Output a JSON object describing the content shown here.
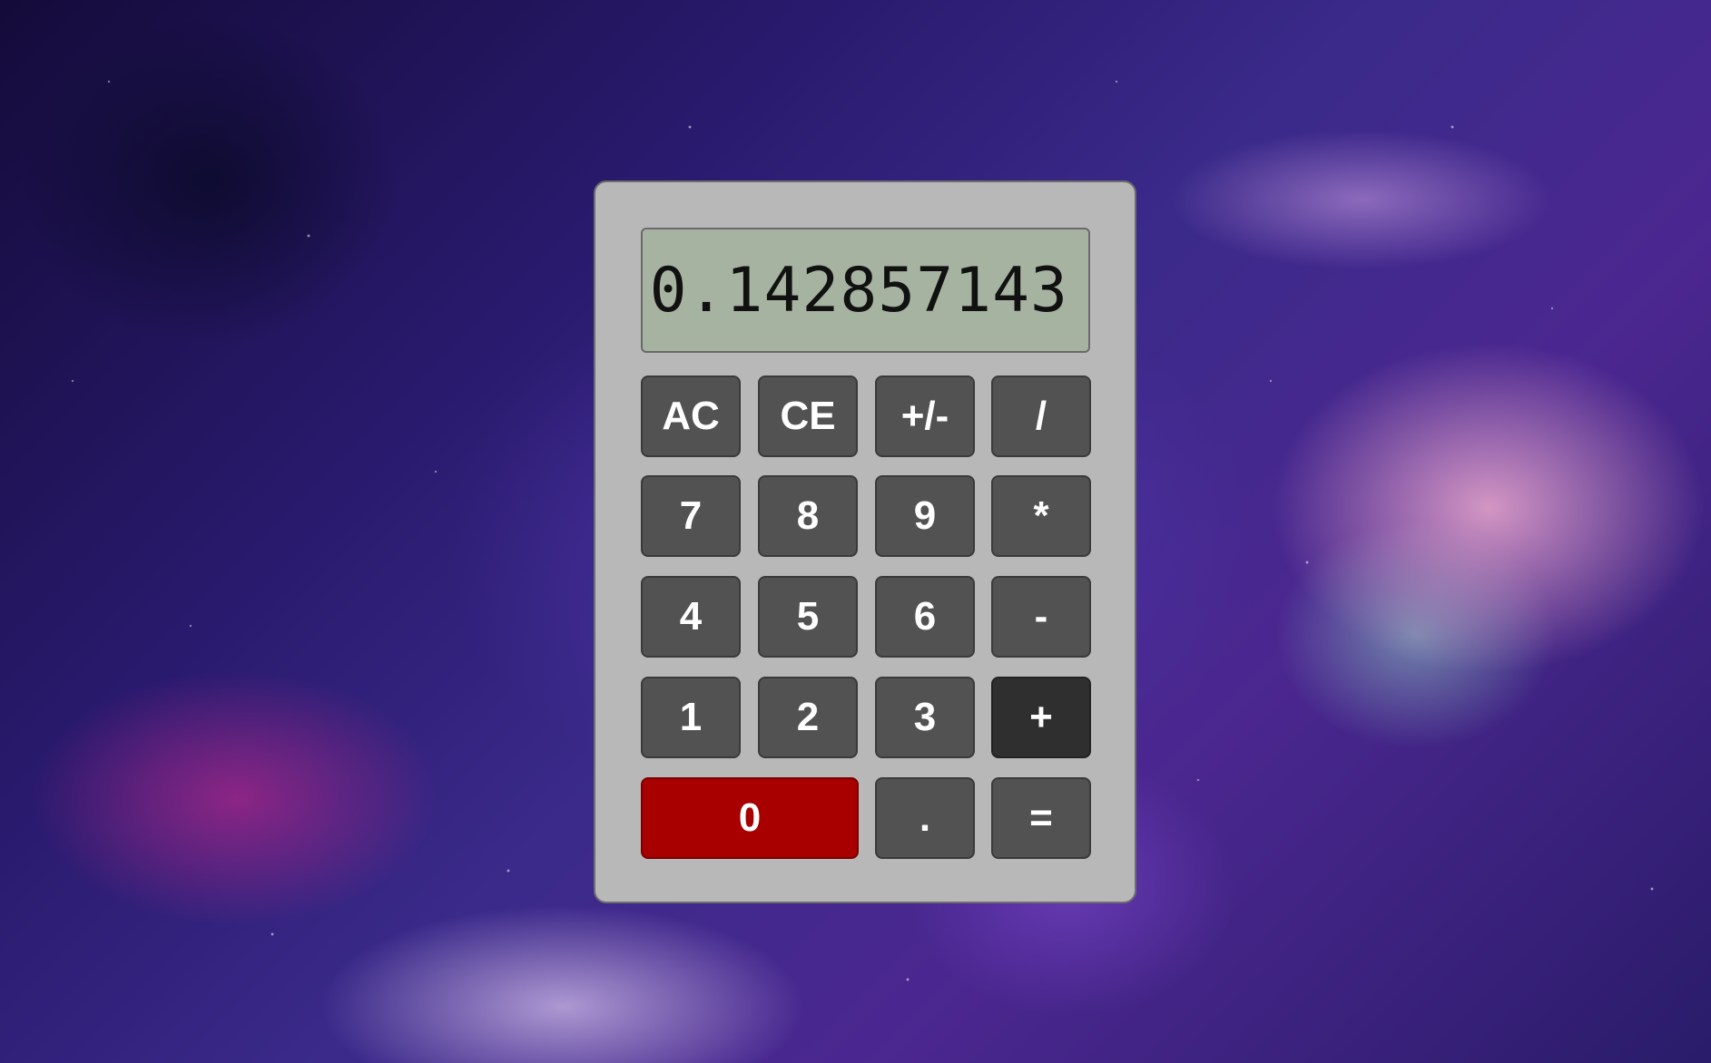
{
  "display": {
    "value": "0.142857143"
  },
  "keys": {
    "ac": "AC",
    "ce": "CE",
    "sign": "+/-",
    "divide": "/",
    "seven": "7",
    "eight": "8",
    "nine": "9",
    "multiply": "*",
    "four": "4",
    "five": "5",
    "six": "6",
    "subtract": "-",
    "one": "1",
    "two": "2",
    "three": "3",
    "add": "+",
    "zero": "0",
    "decimal": ".",
    "equals": "="
  },
  "colors": {
    "body": "#b8b8b8",
    "display": "#a7b3a1",
    "key": "#525252",
    "key_active": "#2f2f2f",
    "zero_key": "#a80000"
  },
  "background": "galaxy-nebula-image"
}
